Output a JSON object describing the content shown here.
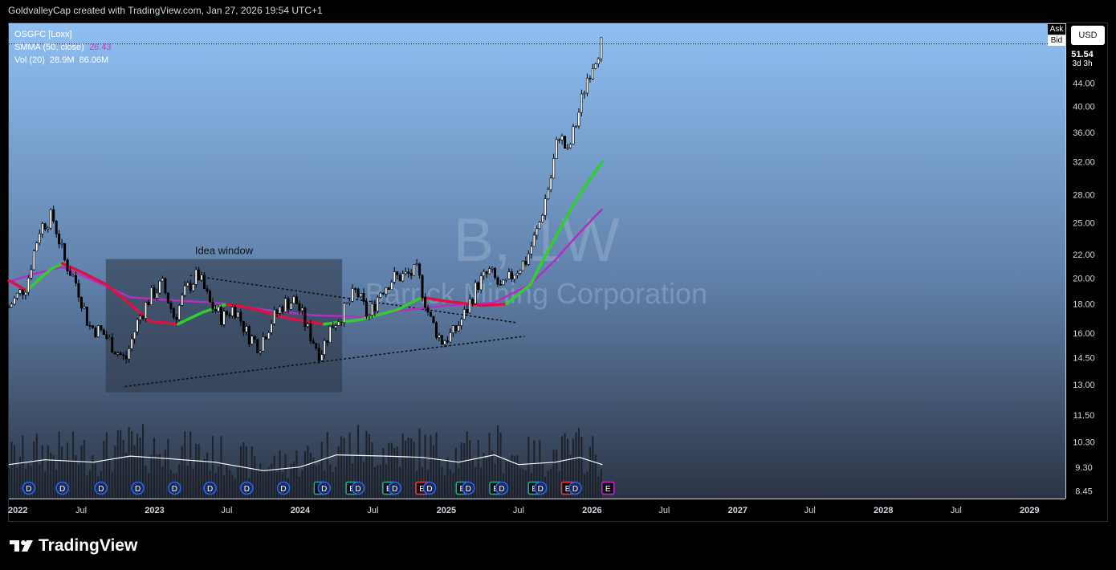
{
  "caption": "GoldvalleyCap created with TradingView.com, Jan 27, 2026 19:54 UTC+1",
  "legend": {
    "symbol": "OSGFC [Loxx]",
    "smma_label": "SMMA (50, close)",
    "smma_value": "26.43",
    "vol_label": "Vol (20)",
    "vol_value1": "28.9M",
    "vol_value2": "86.06M"
  },
  "watermark": {
    "ticker": "B, 1W",
    "name": "Barrick Mining Corporation"
  },
  "buttons": {
    "currency": "USD",
    "ask": "Ask",
    "bid": "Bid"
  },
  "last_price": {
    "value": "51.54",
    "countdown": "3d 3h"
  },
  "footer_brand": "TradingView",
  "colors": {
    "background_top": "#8fbff2",
    "background_bottom": "#2c3444",
    "smma_bull": "#33cc33",
    "smma_bear": "#dd1144",
    "smma_purple": "#b030c0",
    "candle_up": "#ffffff",
    "candle_down": "#000000"
  },
  "chart_data": {
    "type": "candlestick",
    "timeframe": "1W",
    "x_tick_labels": [
      "2022",
      "Jul",
      "2023",
      "Jul",
      "2024",
      "Jul",
      "2025",
      "Jul",
      "2026",
      "Jul",
      "2027",
      "Jul",
      "2028",
      "Jul",
      "2029"
    ],
    "y_scale": "log",
    "y_tick_labels": [
      "44.00",
      "40.00",
      "36.00",
      "32.00",
      "28.00",
      "25.00",
      "22.00",
      "20.00",
      "18.00",
      "16.00",
      "14.50",
      "13.00",
      "11.50",
      "10.30",
      "9.30",
      "8.45"
    ],
    "ylim": [
      8.2,
      56
    ],
    "x_range": [
      "2022-01-01",
      "2029-04-01"
    ],
    "last_price": 51.54,
    "price_path": [
      [
        "2022-01-01",
        17.8
      ],
      [
        "2022-02-15",
        19.5
      ],
      [
        "2022-03-20",
        24.5
      ],
      [
        "2022-04-20",
        25.7
      ],
      [
        "2022-05-20",
        21.5
      ],
      [
        "2022-06-20",
        19.5
      ],
      [
        "2022-07-20",
        16.5
      ],
      [
        "2022-08-25",
        16.0
      ],
      [
        "2022-09-25",
        15.0
      ],
      [
        "2022-10-20",
        14.3
      ],
      [
        "2022-11-20",
        16.8
      ],
      [
        "2022-12-20",
        18.5
      ],
      [
        "2023-01-20",
        19.5
      ],
      [
        "2023-02-20",
        17.0
      ],
      [
        "2023-03-20",
        19.0
      ],
      [
        "2023-04-20",
        20.3
      ],
      [
        "2023-05-20",
        18.0
      ],
      [
        "2023-06-20",
        17.0
      ],
      [
        "2023-07-20",
        17.8
      ],
      [
        "2023-08-20",
        16.0
      ],
      [
        "2023-09-20",
        15.2
      ],
      [
        "2023-10-20",
        16.8
      ],
      [
        "2023-11-20",
        18.0
      ],
      [
        "2023-12-20",
        18.3
      ],
      [
        "2024-01-20",
        16.2
      ],
      [
        "2024-02-20",
        14.7
      ],
      [
        "2024-03-20",
        16.5
      ],
      [
        "2024-04-20",
        17.5
      ],
      [
        "2024-05-20",
        19.0
      ],
      [
        "2024-06-20",
        17.0
      ],
      [
        "2024-07-20",
        19.0
      ],
      [
        "2024-08-20",
        20.0
      ],
      [
        "2024-09-20",
        20.2
      ],
      [
        "2024-10-20",
        20.5
      ],
      [
        "2024-11-20",
        17.0
      ],
      [
        "2024-12-20",
        15.5
      ],
      [
        "2025-01-20",
        16.0
      ],
      [
        "2025-02-20",
        17.5
      ],
      [
        "2025-03-20",
        19.5
      ],
      [
        "2025-04-20",
        20.5
      ],
      [
        "2025-05-20",
        19.0
      ],
      [
        "2025-06-20",
        20.5
      ],
      [
        "2025-07-20",
        21.5
      ],
      [
        "2025-08-20",
        24.5
      ],
      [
        "2025-09-20",
        30.0
      ],
      [
        "2025-10-10",
        36.0
      ],
      [
        "2025-11-01",
        33.0
      ],
      [
        "2025-11-25",
        38.0
      ],
      [
        "2025-12-20",
        45.0
      ],
      [
        "2026-01-10",
        49.0
      ],
      [
        "2026-01-27",
        52.0
      ]
    ],
    "smma_fast": [
      [
        "2022-01-01",
        19.8
      ],
      [
        "2022-02-15",
        19.0
      ],
      [
        "2022-04-15",
        20.7
      ],
      [
        "2022-05-15",
        21.2
      ],
      [
        "2022-07-01",
        20.5
      ],
      [
        "2022-09-01",
        19.5
      ],
      [
        "2022-11-01",
        18.0
      ],
      [
        "2022-12-20",
        16.8
      ],
      [
        "2023-03-01",
        16.6
      ],
      [
        "2023-05-01",
        17.4
      ],
      [
        "2023-07-01",
        18.0
      ],
      [
        "2023-09-01",
        17.7
      ],
      [
        "2023-12-01",
        17.0
      ],
      [
        "2024-03-01",
        16.6
      ],
      [
        "2024-06-01",
        16.9
      ],
      [
        "2024-09-01",
        17.6
      ],
      [
        "2024-11-01",
        18.5
      ],
      [
        "2025-01-01",
        18.2
      ],
      [
        "2025-04-01",
        17.9
      ],
      [
        "2025-06-01",
        18.0
      ],
      [
        "2025-08-01",
        19.5
      ],
      [
        "2025-10-01",
        23.5
      ],
      [
        "2025-12-01",
        28.0
      ],
      [
        "2026-01-27",
        32.0
      ]
    ],
    "smma_fast_color_segments": [
      [
        "2022-01-01",
        "2022-02-15",
        "bear"
      ],
      [
        "2022-02-15",
        "2022-05-15",
        "bull"
      ],
      [
        "2022-05-15",
        "2023-03-01",
        "bear"
      ],
      [
        "2023-03-01",
        "2023-07-01",
        "bull"
      ],
      [
        "2023-07-01",
        "2024-03-01",
        "bear"
      ],
      [
        "2024-03-01",
        "2024-11-01",
        "bull"
      ],
      [
        "2024-11-01",
        "2025-06-01",
        "bear"
      ],
      [
        "2025-06-01",
        "2026-01-27",
        "bull"
      ]
    ],
    "smma_slow": [
      [
        "2022-01-01",
        19.7
      ],
      [
        "2022-03-01",
        20.3
      ],
      [
        "2022-05-15",
        20.9
      ],
      [
        "2022-08-01",
        19.8
      ],
      [
        "2022-11-01",
        18.5
      ],
      [
        "2023-02-01",
        18.3
      ],
      [
        "2023-06-01",
        18.1
      ],
      [
        "2023-10-01",
        17.6
      ],
      [
        "2024-02-01",
        17.2
      ],
      [
        "2024-06-01",
        17.1
      ],
      [
        "2024-10-01",
        17.6
      ],
      [
        "2025-01-01",
        17.9
      ],
      [
        "2025-05-01",
        18.1
      ],
      [
        "2025-08-01",
        19.5
      ],
      [
        "2025-10-01",
        21.5
      ],
      [
        "2025-12-01",
        24.0
      ],
      [
        "2026-01-27",
        26.43
      ]
    ],
    "volume_ma": [
      [
        "2022-01-01",
        0.28
      ],
      [
        "2022-04-01",
        0.32
      ],
      [
        "2022-08-01",
        0.3
      ],
      [
        "2022-11-01",
        0.35
      ],
      [
        "2023-02-01",
        0.33
      ],
      [
        "2023-06-01",
        0.3
      ],
      [
        "2023-10-01",
        0.23
      ],
      [
        "2024-01-01",
        0.26
      ],
      [
        "2024-04-01",
        0.36
      ],
      [
        "2024-08-01",
        0.35
      ],
      [
        "2024-11-01",
        0.34
      ],
      [
        "2025-02-01",
        0.3
      ],
      [
        "2025-05-01",
        0.36
      ],
      [
        "2025-07-01",
        0.28
      ],
      [
        "2025-10-01",
        0.3
      ],
      [
        "2025-12-01",
        0.34
      ],
      [
        "2026-01-27",
        0.28
      ]
    ],
    "volume_scale_max": 1.0,
    "annotations": [
      {
        "type": "rect",
        "label": "Idea window",
        "x0": "2022-09-01",
        "x1": "2024-04-15",
        "y0": 12.6,
        "y1": 21.6
      },
      {
        "type": "trendline_dotted",
        "points": [
          [
            "2023-04-01",
            20.2
          ],
          [
            "2025-06-25",
            16.7
          ]
        ]
      },
      {
        "type": "trendline_dotted",
        "points": [
          [
            "2022-10-20",
            12.9
          ],
          [
            "2025-07-15",
            15.8
          ]
        ]
      }
    ],
    "event_markers": [
      {
        "date": "2022-02-20",
        "type": "D"
      },
      {
        "date": "2022-05-15",
        "type": "D"
      },
      {
        "date": "2022-08-20",
        "type": "D"
      },
      {
        "date": "2022-11-20",
        "type": "D"
      },
      {
        "date": "2023-02-20",
        "type": "D"
      },
      {
        "date": "2023-05-20",
        "type": "D"
      },
      {
        "date": "2023-08-20",
        "type": "D"
      },
      {
        "date": "2023-11-20",
        "type": "D"
      },
      {
        "date": "2024-02-20",
        "type": "E"
      },
      {
        "date": "2024-03-01",
        "type": "D"
      },
      {
        "date": "2024-05-10",
        "type": "E"
      },
      {
        "date": "2024-05-25",
        "type": "D"
      },
      {
        "date": "2024-08-10",
        "type": "E"
      },
      {
        "date": "2024-08-25",
        "type": "D"
      },
      {
        "date": "2024-11-01",
        "type": "E_red"
      },
      {
        "date": "2024-11-20",
        "type": "D"
      },
      {
        "date": "2025-02-10",
        "type": "E"
      },
      {
        "date": "2025-02-25",
        "type": "D"
      },
      {
        "date": "2025-05-05",
        "type": "E"
      },
      {
        "date": "2025-05-20",
        "type": "D"
      },
      {
        "date": "2025-08-10",
        "type": "E"
      },
      {
        "date": "2025-08-25",
        "type": "D"
      },
      {
        "date": "2025-11-01",
        "type": "E_red"
      },
      {
        "date": "2025-11-20",
        "type": "D"
      },
      {
        "date": "2026-02-10",
        "type": "E_purple"
      }
    ]
  }
}
